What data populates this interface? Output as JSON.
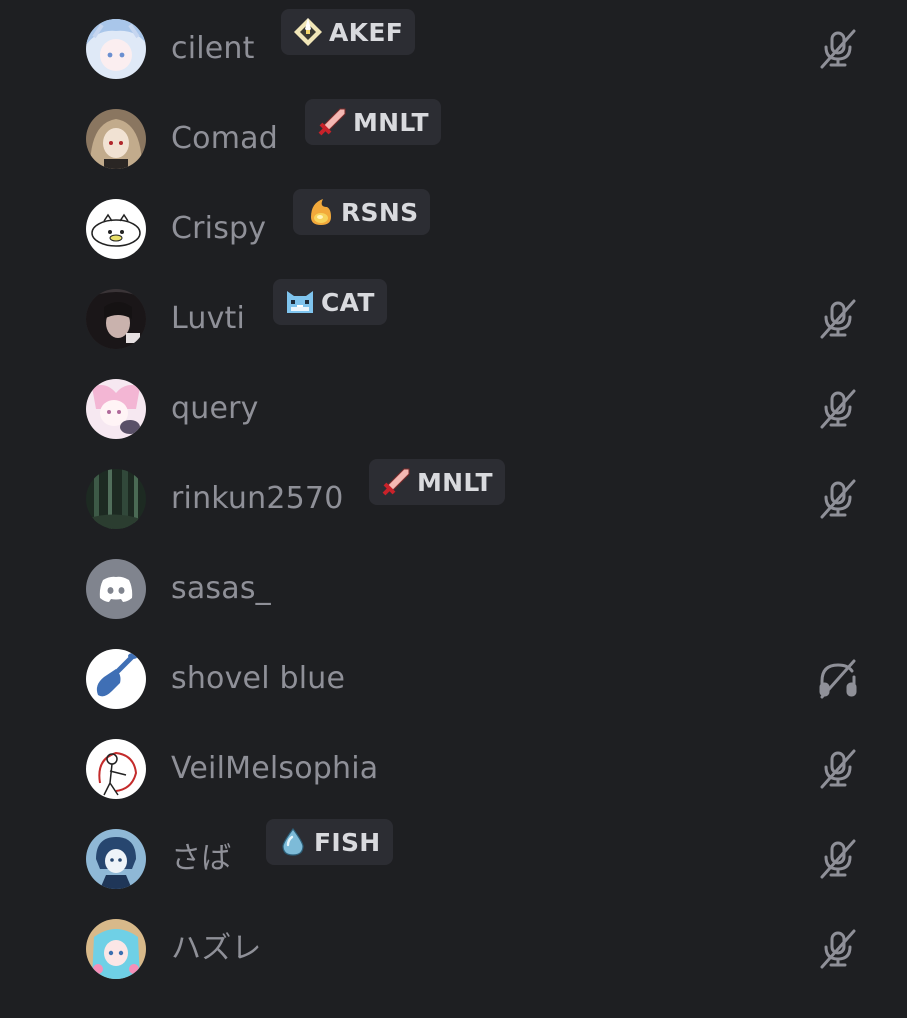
{
  "members": [
    {
      "name": "cilent",
      "tag": {
        "text": "AKEF",
        "icon": "diamond-shard-icon"
      },
      "status_icon": "mic-muted-icon"
    },
    {
      "name": "Comad",
      "tag": {
        "text": "MNLT",
        "icon": "sword-icon"
      },
      "status_icon": null
    },
    {
      "name": "Crispy",
      "tag": {
        "text": "RSNS",
        "icon": "flame-orb-icon"
      },
      "status_icon": null
    },
    {
      "name": "Luvti",
      "tag": {
        "text": "CAT",
        "icon": "cat-face-icon"
      },
      "status_icon": "mic-muted-icon"
    },
    {
      "name": "query",
      "tag": null,
      "status_icon": "mic-muted-icon"
    },
    {
      "name": "rinkun2570",
      "tag": {
        "text": "MNLT",
        "icon": "sword-icon"
      },
      "status_icon": "mic-muted-icon"
    },
    {
      "name": "sasas_",
      "tag": null,
      "status_icon": null
    },
    {
      "name": "shovel blue",
      "tag": null,
      "status_icon": "headphones-deafened-icon"
    },
    {
      "name": "VeilMelsophia",
      "tag": null,
      "status_icon": "mic-muted-icon"
    },
    {
      "name": "さば",
      "tag": {
        "text": "FISH",
        "icon": "water-drop-icon"
      },
      "status_icon": "mic-muted-icon"
    },
    {
      "name": "ハズレ",
      "tag": null,
      "status_icon": "mic-muted-icon"
    }
  ],
  "colors": {
    "background": "#1e1f22",
    "name_text": "#8f9098",
    "tag_bg": "#2c2d33",
    "tag_text": "#d9dade",
    "status_icon": "#8f9098",
    "default_avatar": "#80848e"
  }
}
